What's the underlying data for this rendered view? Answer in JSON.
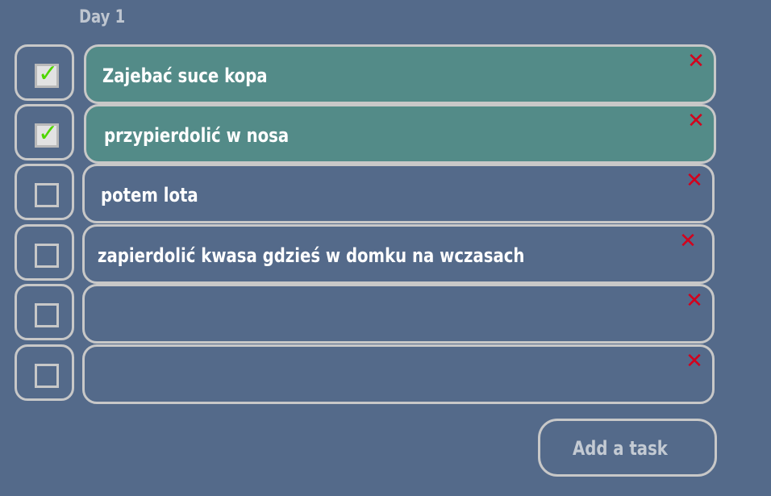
{
  "day": {
    "title": "Day 1"
  },
  "tasks": [
    {
      "text": "Zajebać suce kopa",
      "done": true
    },
    {
      "text": "przypierdolić w nosa",
      "done": true
    },
    {
      "text": "potem lota",
      "done": false
    },
    {
      "text": "zapierdolić kwasa gdzieś w domku na wczasach",
      "done": false
    },
    {
      "text": "",
      "done": false
    },
    {
      "text": "",
      "done": false
    }
  ],
  "icons": {
    "check": "checkmark-icon",
    "delete": "delete-x-icon"
  },
  "colors": {
    "background": "#546a8a",
    "done_task": "#538b88",
    "border": "#c8c8c8",
    "delete": "#d4001c",
    "check": "#4fd600"
  },
  "add_button": {
    "label": "Add a task"
  }
}
